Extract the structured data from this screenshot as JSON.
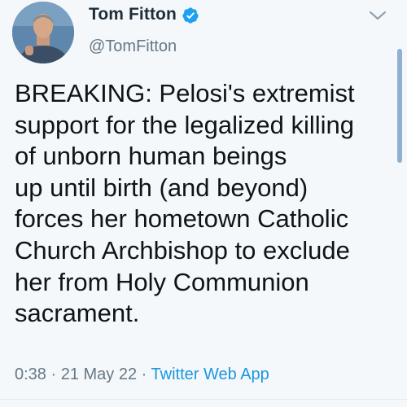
{
  "tweet": {
    "author": {
      "display_name": "Tom Fitton",
      "handle": "@TomFitton",
      "verified": true,
      "avatar_icon": "profile-photo"
    },
    "body_lines": [
      "BREAKING: Pelosi's extremist",
      "support for the legalized killing",
      "of unborn human beings",
      "up until birth (and beyond)",
      "forces her hometown Catholic",
      "Church Archbishop to exclude",
      "her from Holy Communion",
      "sacrament."
    ],
    "meta": {
      "time": "0:38",
      "separator": " · ",
      "date": "21 May 22",
      "app": "Twitter Web App"
    }
  },
  "colors": {
    "background": "#f5f8fa",
    "verified_blue": "#1da1f2",
    "link_blue": "#1b95e0",
    "muted": "#657786"
  },
  "icons": {
    "verified": "verified-badge-icon",
    "menu": "chevron-down-icon"
  }
}
